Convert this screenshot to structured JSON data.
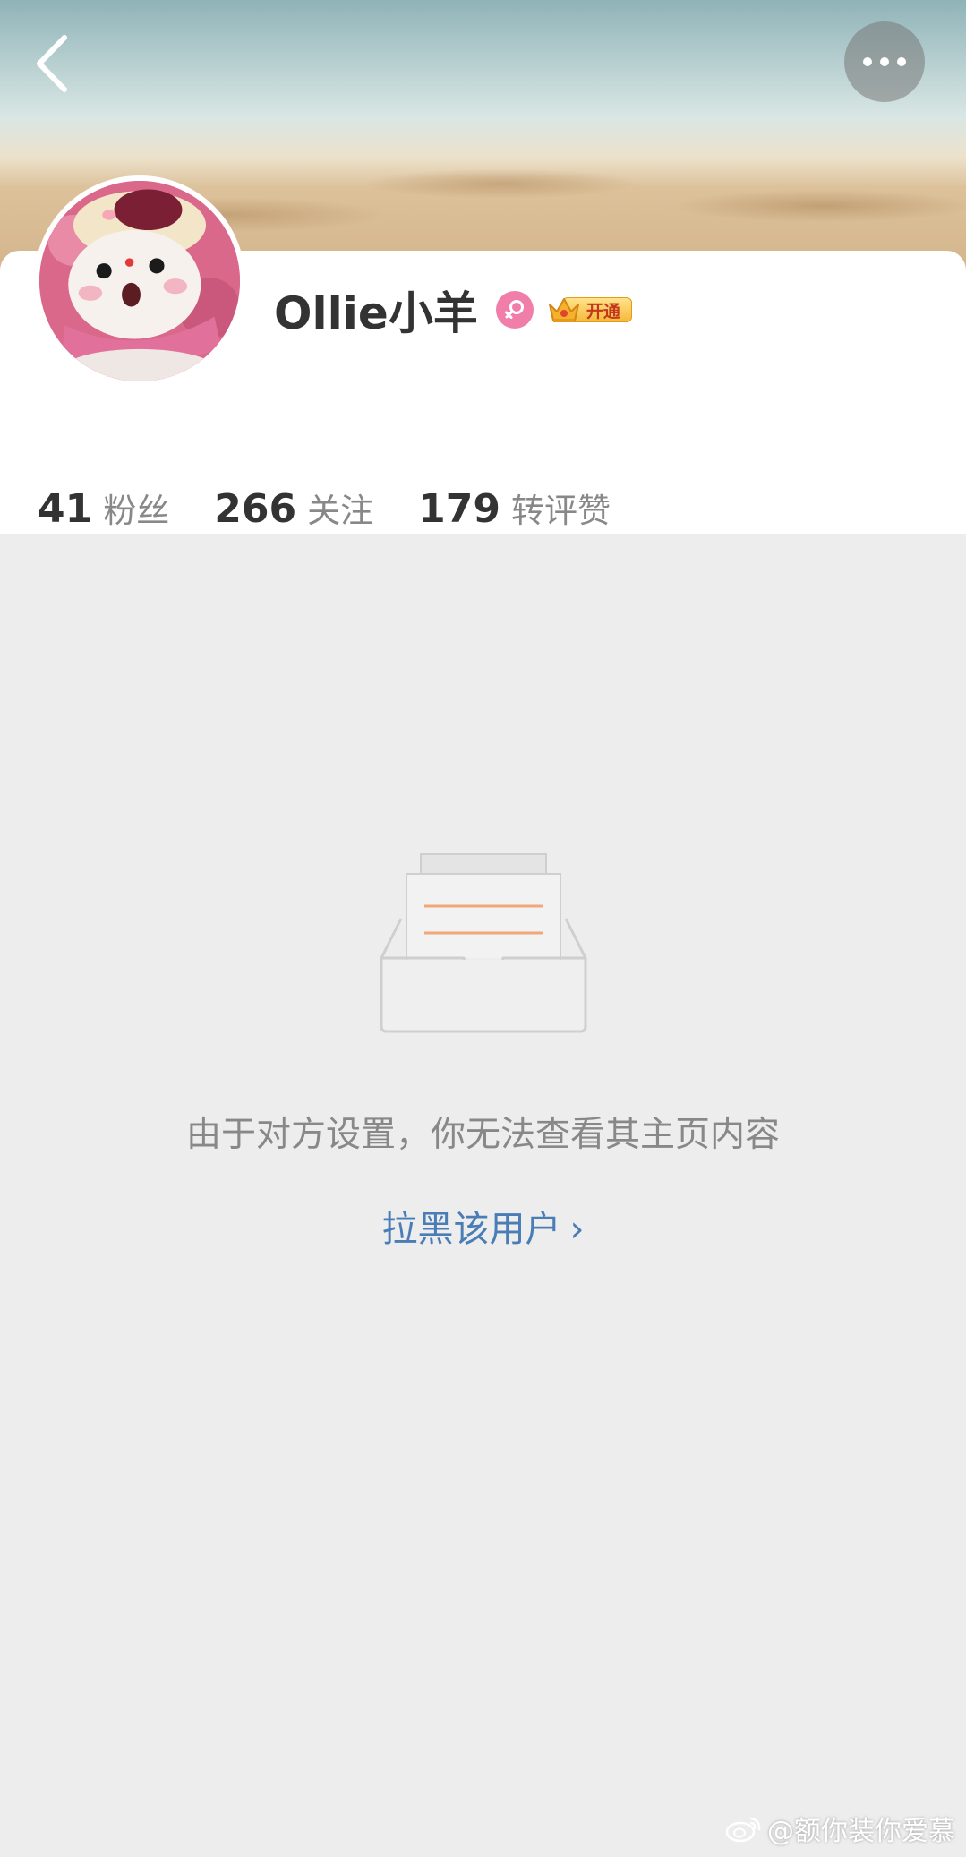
{
  "header": {
    "back_icon": "chevron-left-icon",
    "more_icon": "more-horizontal-icon"
  },
  "profile": {
    "username": "Ollie小羊",
    "gender_icon": "female-icon",
    "vip_badge_label": "开通",
    "stats": [
      {
        "value": "41",
        "label": "粉丝"
      },
      {
        "value": "266",
        "label": "关注"
      },
      {
        "value": "179",
        "label": "转评赞"
      }
    ]
  },
  "empty_state": {
    "icon": "empty-box-icon",
    "message": "由于对方设置，你无法查看其主页内容",
    "block_link": "拉黑该用户",
    "block_link_chevron": "›"
  },
  "watermark": {
    "icon": "weibo-logo-icon",
    "text": "@额你装你爱慕"
  },
  "colors": {
    "link": "#4a7db6",
    "gender_badge": "#f07ea8",
    "background": "#ededed"
  }
}
